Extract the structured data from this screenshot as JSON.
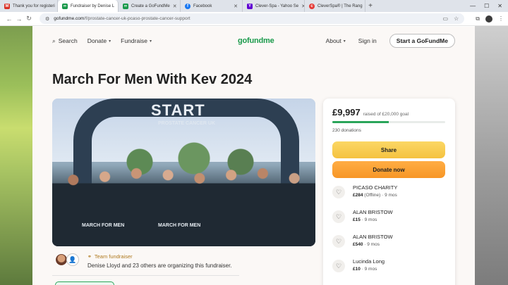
{
  "browser": {
    "tabs": [
      {
        "title": "Thank you for registeri",
        "favicon": "gmail-icon",
        "color": "#d93025",
        "active": false
      },
      {
        "title": "Fundraiser by Denise L",
        "favicon": "gofundme-icon",
        "color": "#1a9a4b",
        "active": true
      },
      {
        "title": "Create a GoFundMe",
        "favicon": "gofundme-icon",
        "color": "#1a9a4b",
        "active": false
      },
      {
        "title": "Facebook",
        "favicon": "facebook-icon",
        "color": "#1877f2",
        "active": false
      },
      {
        "title": "Clever-Spa - Yahoo Se",
        "favicon": "yahoo-icon",
        "color": "#6001d2",
        "active": false
      },
      {
        "title": "CleverSpa® | The Rang",
        "favicon": "cleverspa-icon",
        "color": "#e53935",
        "active": false
      }
    ],
    "url_host": "gofundme.com",
    "url_path": "/f/prostate-cancer-uk-pcaso-prostate-cancer-support"
  },
  "nav": {
    "search": "Search",
    "donate": "Donate",
    "fundraise": "Fundraise",
    "logo": "gofundme",
    "about": "About",
    "sign_in": "Sign in",
    "start": "Start a GoFundMe"
  },
  "title": "March For Men With Kev 2024",
  "hero": {
    "sign": "START",
    "sub": "PROSTATE CANCER UK",
    "shirt1": "MARCH FOR MEN",
    "shirt2": "MARCH FOR MEN"
  },
  "organizer": {
    "team_label": "Team fundraiser",
    "text": "Denise Lloyd and 23 others are organizing this fundraiser."
  },
  "donation": {
    "raised": "£9,997",
    "goal_text": "raised of £20,000 goal",
    "progress": 0.5,
    "count": "230 donations",
    "share": "Share",
    "donate": "Donate now",
    "donors": [
      {
        "name": "PICASO CHARITY",
        "amount": "£284",
        "note": "(Offline)",
        "time": "9 mos"
      },
      {
        "name": "ALAN BRISTOW",
        "amount": "£15",
        "note": "",
        "time": "9 mos"
      },
      {
        "name": "ALAN BRISTOW",
        "amount": "£540",
        "note": "",
        "time": "9 mos"
      },
      {
        "name": "Lucinda Long",
        "amount": "£10",
        "note": "",
        "time": "9 mos"
      }
    ]
  }
}
